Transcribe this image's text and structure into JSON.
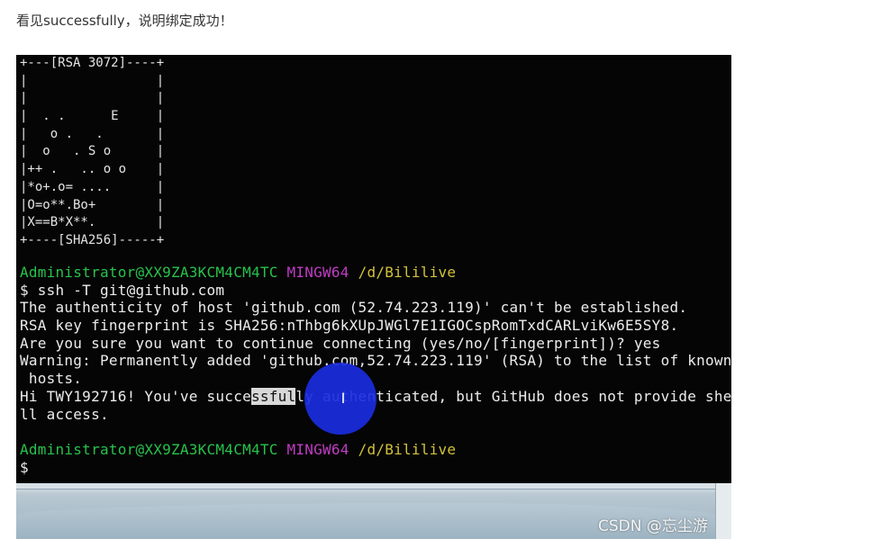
{
  "caption": "看见successfully，说明绑定成功！",
  "terminal": {
    "art": [
      "+---[RSA 3072]----+",
      "|                 |",
      "|                 |",
      "|  . .      E     |",
      "|   o .   .       |",
      "|  o   . S o      |",
      "|++ .   .. o o    |",
      "|*o+.o= ....      |",
      "|O=o**.Bo+        |",
      "|X==B*X**.        |",
      "+----[SHA256]-----+"
    ],
    "prompt1": {
      "user": "Administrator@XX9ZA3KCM4CM4TC",
      "env": "MINGW64",
      "path": "/d/Bililive"
    },
    "command": "$ ssh -T git@github.com",
    "output": [
      "The authenticity of host 'github.com (52.74.223.119)' can't be established.",
      "RSA key fingerprint is SHA256:nThbg6kXUpJWGl7E1IGOCspRomTxdCARLviKw6E5SY8.",
      "Are you sure you want to continue connecting (yes/no/[fingerprint])? yes",
      "Warning: Permanently added 'github.com,52.74.223.119' (RSA) to the list of known",
      " hosts."
    ],
    "success_line": {
      "before": "Hi TWY192716! You've succe",
      "selected": "ssful",
      "after": "ly authenticated, but GitHub does not provide she"
    },
    "success_line_cont": "ll access.",
    "prompt2": {
      "user": "Administrator@XX9ZA3KCM4CM4TC",
      "env": "MINGW64",
      "path": "/d/Bililive"
    },
    "final_prompt": "$"
  },
  "cursor_glyph": "I",
  "watermark": "CSDN @忘尘游"
}
